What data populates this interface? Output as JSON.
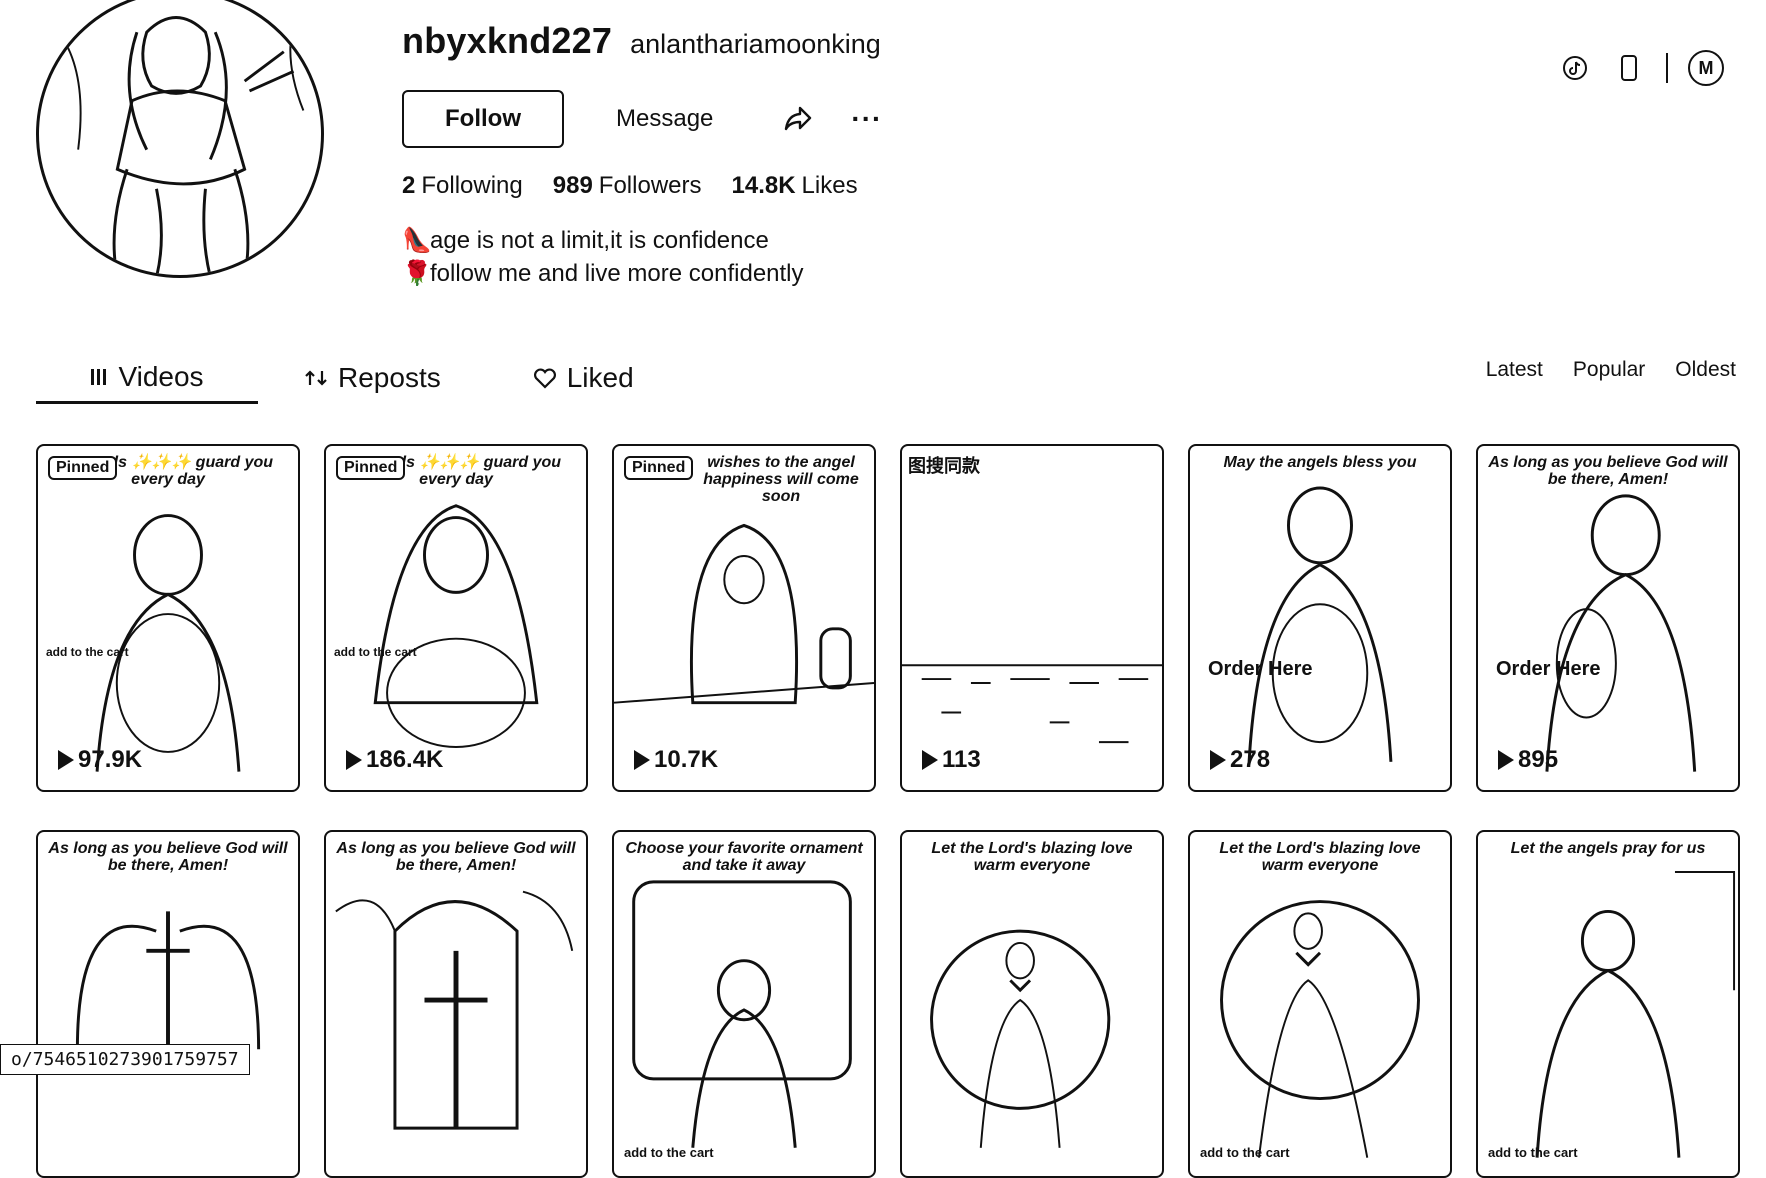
{
  "profile": {
    "username": "nbyxknd227",
    "nickname": "anlanthariamoonking",
    "follow_label": "Follow",
    "message_label": "Message",
    "more_label": "···",
    "stats": [
      {
        "value": "2",
        "label": "Following"
      },
      {
        "value": "989",
        "label": "Followers"
      },
      {
        "value": "14.8K",
        "label": "Likes"
      }
    ],
    "bio": [
      {
        "icon": "high-heel-icon",
        "text": "age is not a limit,it is confidence"
      },
      {
        "icon": "rose-icon",
        "text": "follow me and live more confidently"
      }
    ]
  },
  "top_bar": {
    "account_initial": "M"
  },
  "tabs": [
    {
      "label": "Videos",
      "icon": "grid-icon",
      "active": true
    },
    {
      "label": "Reposts",
      "icon": "repost-icon",
      "active": false
    },
    {
      "label": "Liked",
      "icon": "heart-icon",
      "active": false
    }
  ],
  "sort": [
    "Latest",
    "Popular",
    "Oldest"
  ],
  "videos": [
    {
      "badge": "Pinned",
      "caption": "e angels ✨✨✨ guard you every day",
      "views": "97.9K",
      "side_tag": "add to the cart"
    },
    {
      "badge": "Pinned",
      "caption": "e angels ✨✨✨ guard you every day",
      "views": "186.4K",
      "side_tag": "add to the cart"
    },
    {
      "badge": "Pinned",
      "caption": "wishes to the angel happiness will come soon",
      "views": "10.7K"
    },
    {
      "label": "图搜同款",
      "views": "113"
    },
    {
      "caption": "May the angels bless you",
      "views": "278",
      "order_tag": "Order Here"
    },
    {
      "caption": "As long as you believe God will be there, Amen!",
      "views": "895",
      "order_tag": "Order Here"
    },
    {
      "caption": "As long as you believe God will be there, Amen!"
    },
    {
      "caption": "As long as you believe God will be there, Amen!"
    },
    {
      "caption": "Choose your favorite ornament and take it away",
      "cart_tag": "add to the cart"
    },
    {
      "caption": "Let the Lord's blazing love warm everyone"
    },
    {
      "caption": "Let the Lord's blazing love warm everyone",
      "cart_tag": "add to the cart"
    },
    {
      "caption": "Let the angels pray for us",
      "cart_tag": "add to the cart"
    }
  ],
  "status_url": "o/7546510273901759757"
}
